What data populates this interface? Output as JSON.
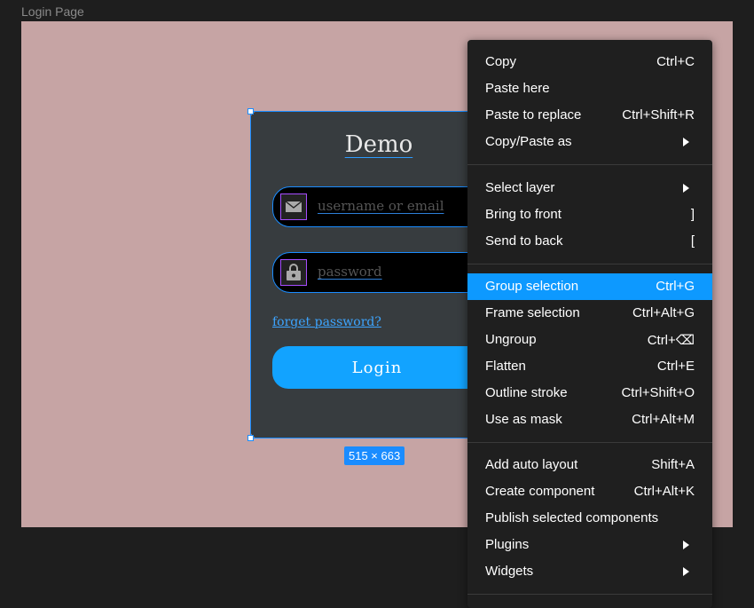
{
  "frame": {
    "label": "Login Page"
  },
  "card": {
    "title": "Demo",
    "username_placeholder": "username or email",
    "password_placeholder": "password",
    "forgot_link": "forget password?",
    "login_label": "Login"
  },
  "selection": {
    "size_badge": "515 × 663"
  },
  "menu": {
    "items": [
      {
        "label": "Copy",
        "shortcut": "Ctrl+C"
      },
      {
        "label": "Paste here",
        "shortcut": ""
      },
      {
        "label": "Paste to replace",
        "shortcut": "Ctrl+Shift+R"
      },
      {
        "label": "Copy/Paste as",
        "shortcut": ""
      },
      {
        "label": "Select layer",
        "shortcut": ""
      },
      {
        "label": "Bring to front",
        "shortcut": "]"
      },
      {
        "label": "Send to back",
        "shortcut": "["
      },
      {
        "label": "Group selection",
        "shortcut": "Ctrl+G"
      },
      {
        "label": "Frame selection",
        "shortcut": "Ctrl+Alt+G"
      },
      {
        "label": "Ungroup",
        "shortcut": "Ctrl+⌫"
      },
      {
        "label": "Flatten",
        "shortcut": "Ctrl+E"
      },
      {
        "label": "Outline stroke",
        "shortcut": "Ctrl+Shift+O"
      },
      {
        "label": "Use as mask",
        "shortcut": "Ctrl+Alt+M"
      },
      {
        "label": "Add auto layout",
        "shortcut": "Shift+A"
      },
      {
        "label": "Create component",
        "shortcut": "Ctrl+Alt+K"
      },
      {
        "label": "Publish selected components",
        "shortcut": ""
      },
      {
        "label": "Plugins",
        "shortcut": ""
      },
      {
        "label": "Widgets",
        "shortcut": ""
      }
    ],
    "active_item": "Group selection"
  },
  "colors": {
    "canvas": "#c6a4a4",
    "card": "#373c3f",
    "accent": "#0d99ff",
    "selection": "#1a8cff",
    "icon_border": "#a64dff"
  }
}
